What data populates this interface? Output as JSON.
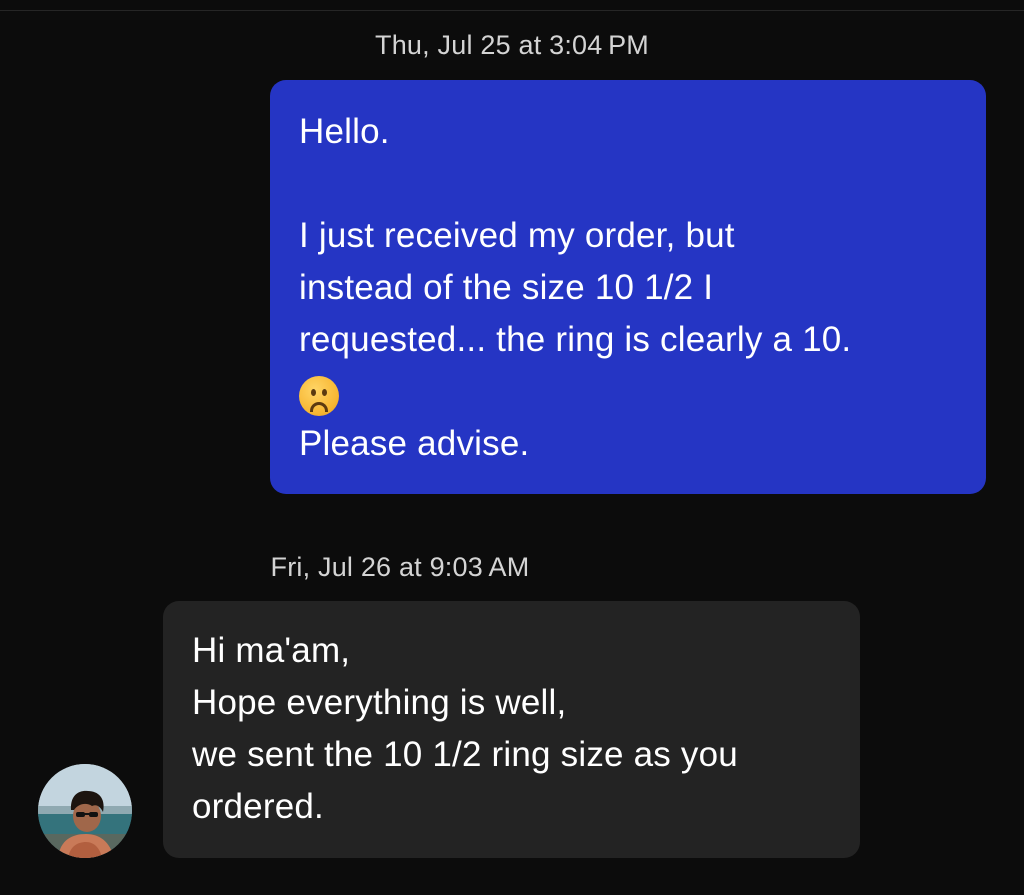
{
  "conversation": {
    "timestamps": {
      "first": "Thu, Jul 25 at 3:04 PM",
      "second": "Fri, Jul 26 at 9:03 AM"
    },
    "outgoing_message": {
      "lines": [
        "Hello.",
        "I just received my order, but",
        "instead of the size 10 1/2 I",
        "requested... the ring is clearly a 10.",
        "Please advise."
      ],
      "emoji": "frowning-face-icon",
      "bubble_color": "#2535c4"
    },
    "incoming_message": {
      "lines": [
        "Hi ma'am,",
        "Hope everything is well,",
        "we sent the 10 1/2 ring size as you",
        "ordered."
      ],
      "bubble_color": "#232323"
    },
    "sender_avatar": "avatar-photo"
  },
  "colors": {
    "background": "#0c0c0c",
    "timestamp_text": "#d4d4d4"
  }
}
